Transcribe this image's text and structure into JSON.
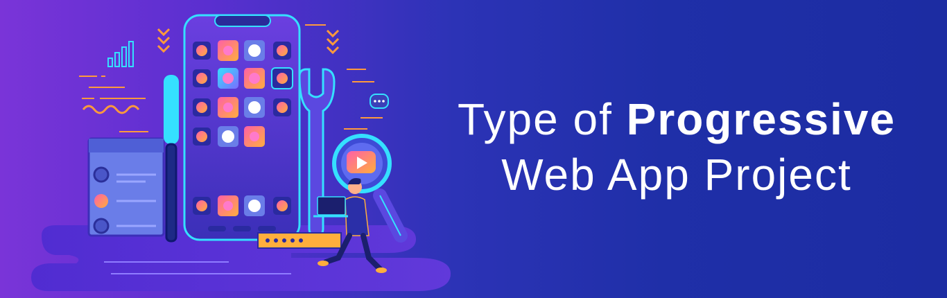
{
  "headline": {
    "line1_regular": "Type of ",
    "line1_bold": "Progressive",
    "line2": "Web App Project"
  },
  "colors": {
    "background_left": "#7a34d8",
    "background_right": "#1c2ca2",
    "accent_cyan": "#35e0ff",
    "accent_orange": "#ff9a3c",
    "accent_pink": "#ff4fa3",
    "text": "#ffffff"
  },
  "icons": [
    "smartphone-icon",
    "screwdriver-icon",
    "wrench-icon",
    "magnifier-icon",
    "play-icon",
    "bar-chart-icon",
    "chat-bubble-icon",
    "developer-figure",
    "laptop-icon",
    "form-card-icon"
  ]
}
